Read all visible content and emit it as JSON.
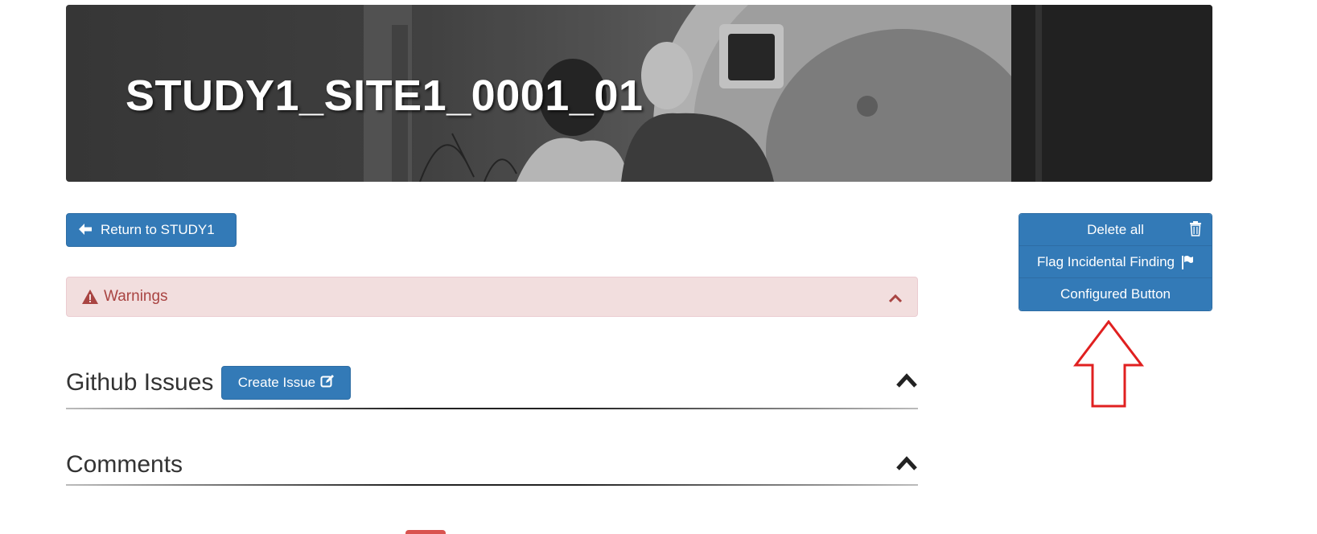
{
  "banner": {
    "title": "STUDY1_SITE1_0001_01"
  },
  "return_button": {
    "label": "Return to STUDY1",
    "icon": "arrow-left-icon"
  },
  "warnings": {
    "label": "Warnings",
    "icon": "warning-triangle-icon",
    "collapse_icon": "chevron-up-icon"
  },
  "github_issues": {
    "title": "Github Issues",
    "create_label": "Create Issue",
    "create_icon": "edit-icon",
    "collapse_icon": "chevron-up-icon"
  },
  "comments": {
    "title": "Comments",
    "collapse_icon": "chevron-up-icon"
  },
  "action_buttons": [
    {
      "label": "Delete all",
      "icon": "trash-icon"
    },
    {
      "label": "Flag Incidental Finding",
      "icon": "flag-icon"
    },
    {
      "label": "Configured Button"
    }
  ],
  "colors": {
    "primary": "#337ab7",
    "warning_bg": "#f2dede",
    "warning_text": "#a94442",
    "annotation_arrow": "#e02020"
  }
}
